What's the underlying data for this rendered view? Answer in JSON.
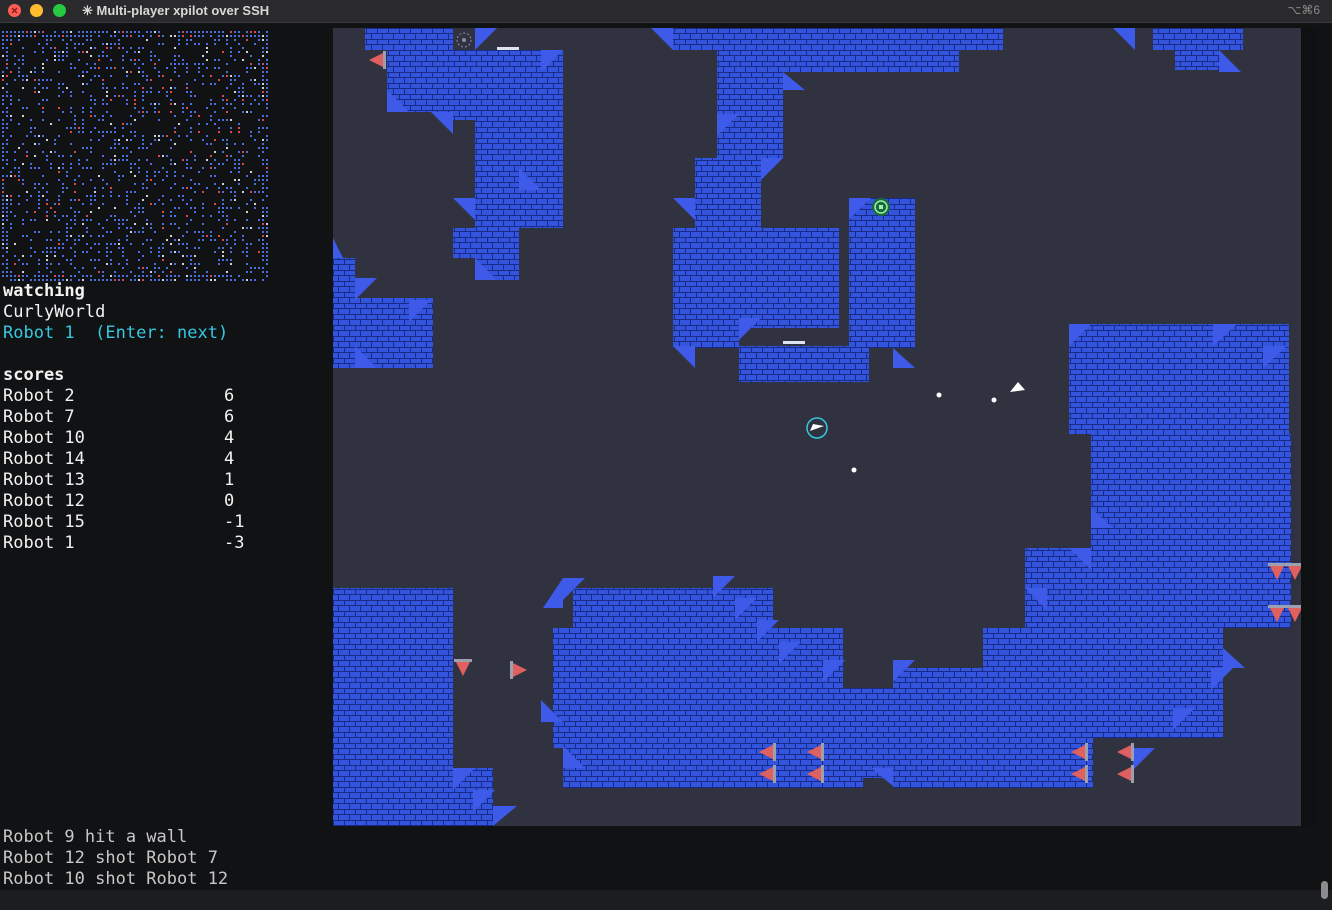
{
  "window": {
    "title": "✳ Multi-player xpilot over SSH",
    "shortcut": "⌥⌘6"
  },
  "status": {
    "mode": "watching",
    "map": "CurlyWorld",
    "player": "Robot 1",
    "hint": "(Enter: next)"
  },
  "scores": {
    "header": "scores",
    "rows": [
      {
        "name": "Robot 2",
        "score": "6"
      },
      {
        "name": "Robot 7",
        "score": "6"
      },
      {
        "name": "Robot 10",
        "score": "4"
      },
      {
        "name": "Robot 14",
        "score": "4"
      },
      {
        "name": "Robot 13",
        "score": "1"
      },
      {
        "name": "Robot 12",
        "score": "0"
      },
      {
        "name": "Robot 15",
        "score": "-1"
      },
      {
        "name": "Robot 1",
        "score": "-3"
      }
    ]
  },
  "log": [
    "Robot 9 hit a wall",
    "Robot 12 shot Robot 7",
    "Robot 10 shot Robot 12"
  ],
  "colors": {
    "wall": "#3355dd",
    "wall_lines": "#1a2a88",
    "arena_bg": "#30323f",
    "cannon": "#e06060",
    "highlight": "#35c8e0"
  }
}
